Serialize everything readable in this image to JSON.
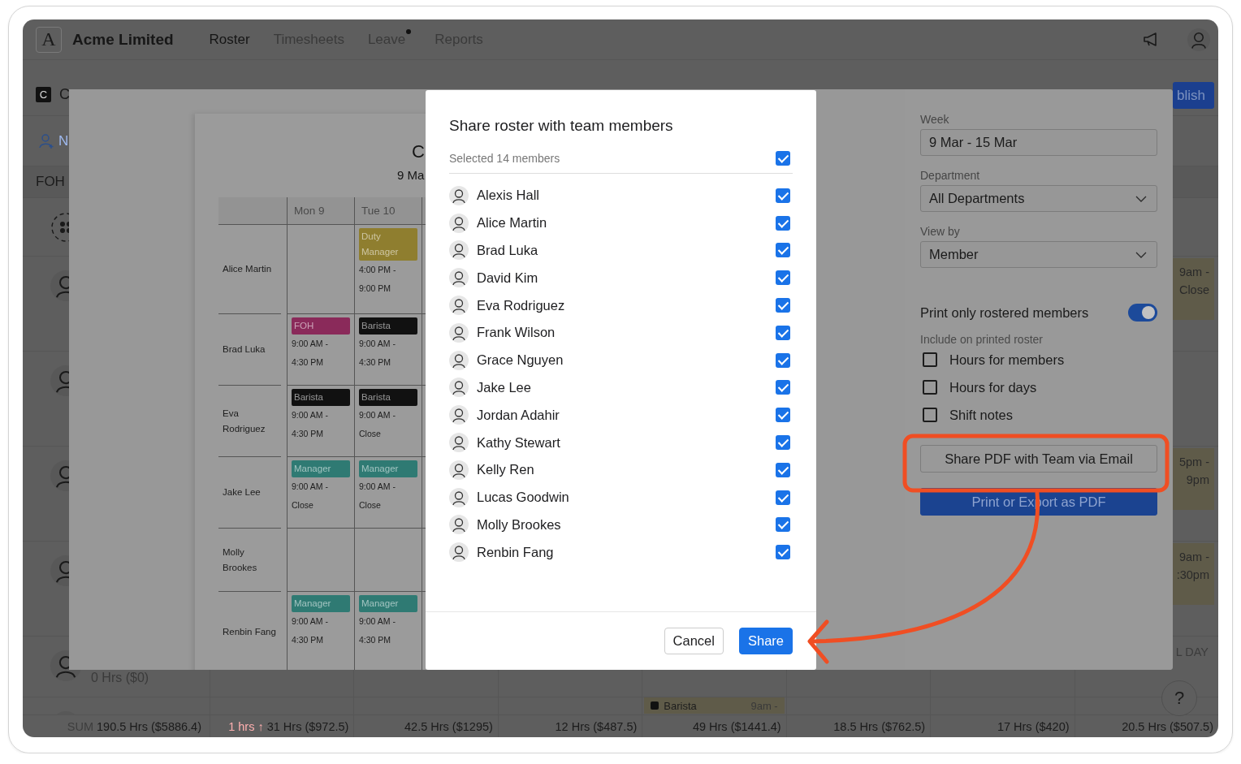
{
  "nav": {
    "logo": "A",
    "company": "Acme Limited",
    "tabs": [
      {
        "label": "Roster",
        "selected": true,
        "dot": false
      },
      {
        "label": "Timesheets",
        "selected": false,
        "dot": false
      },
      {
        "label": "Leave",
        "selected": false,
        "dot": true
      },
      {
        "label": "Reports",
        "selected": false,
        "dot": false
      }
    ]
  },
  "roster": {
    "location_badge": "C",
    "location_name": "C",
    "publish_button": "blish",
    "add_member": "N",
    "department": "FOH",
    "rows": [
      {
        "kind": "open_shifts"
      },
      {
        "kind": "member",
        "shift": {
          "kind": "time",
          "text": "9am - Close"
        }
      },
      {
        "kind": "member"
      },
      {
        "kind": "member",
        "shift": {
          "kind": "time",
          "text": "5pm - 9pm"
        }
      },
      {
        "kind": "member",
        "shift": {
          "kind": "time",
          "text": "9am - :30pm"
        }
      },
      {
        "kind": "member",
        "hours": "0 Hrs ($0)",
        "shift": {
          "kind": "allday",
          "text": "L DAY"
        }
      },
      {
        "kind": "member",
        "shift": {
          "kind": "role",
          "text": "Barista",
          "time": "9am -"
        }
      }
    ],
    "totals": [
      {
        "label": "SUM",
        "value": "190.5 Hrs ($5886.4)"
      },
      {
        "change": "1 hrs ↑",
        "value": "31 Hrs ($972.5)"
      },
      {
        "value": "42.5 Hrs ($1295)"
      },
      {
        "value": "12 Hrs ($487.5)"
      },
      {
        "value": "49 Hrs ($1441.4)"
      },
      {
        "value": "18.5 Hrs ($762.5)"
      },
      {
        "value": "17 Hrs ($420)"
      },
      {
        "value": "20.5 Hrs ($507.5)"
      }
    ],
    "help": "?"
  },
  "print_preview": {
    "title": "C",
    "subtitle": "9 Ma",
    "columns": [
      "Mon 9",
      "Tue 10"
    ],
    "rows": [
      {
        "name": "Alice Martin",
        "shifts": [
          {
            "kind": "none"
          },
          {
            "kind": "shift",
            "role": "Duty Manager",
            "color": "#8f7e2f",
            "time": "4:00 PM - 9:00 PM"
          }
        ]
      },
      {
        "name": "Brad Luka",
        "shifts": [
          {
            "kind": "shift",
            "role": "FOH",
            "color": "#8a2a5a",
            "time": "9:00 AM - 4:30 PM"
          },
          {
            "kind": "shift",
            "role": "Barista",
            "color": "#111111",
            "time": "9:00 AM - 4:30 PM"
          }
        ]
      },
      {
        "name": "Eva Rodriguez",
        "shifts": [
          {
            "kind": "shift",
            "role": "Barista",
            "color": "#111111",
            "time": "9:00 AM - 4:30 PM"
          },
          {
            "kind": "shift",
            "role": "Barista",
            "color": "#111111",
            "time": "9:00 AM - Close"
          }
        ]
      },
      {
        "name": "Jake Lee",
        "shifts": [
          {
            "kind": "shift",
            "role": "Manager",
            "color": "#2f7a73",
            "time": "9:00 AM - Close"
          },
          {
            "kind": "shift",
            "role": "Manager",
            "color": "#2f7a73",
            "time": "9:00 AM - Close"
          }
        ]
      },
      {
        "name": "Molly Brookes",
        "shifts": [
          {
            "kind": "none"
          },
          {
            "kind": "none"
          }
        ]
      },
      {
        "name": "Renbin Fang",
        "shifts": [
          {
            "kind": "shift",
            "role": "Manager",
            "color": "#2f7a73",
            "time": "9:00 AM - 4:30 PM"
          },
          {
            "kind": "shift",
            "role": "Manager",
            "color": "#2f7a73",
            "time": "9:00 AM - 4:30 PM"
          }
        ]
      }
    ]
  },
  "print_settings": {
    "fields": [
      {
        "label": "Week",
        "value": "9 Mar - 15 Mar",
        "kind": "text"
      },
      {
        "label": "Department",
        "value": "All Departments",
        "kind": "select"
      },
      {
        "label": "View by",
        "value": "Member",
        "kind": "select"
      }
    ],
    "toggle": {
      "label": "Print only rostered members",
      "on": true
    },
    "include_label": "Include on printed roster",
    "options": [
      {
        "label": "Hours for members",
        "checked": false
      },
      {
        "label": "Hours for days",
        "checked": false
      },
      {
        "label": "Shift notes",
        "checked": false
      }
    ],
    "buttons": [
      {
        "label": "Share PDF with Team via Email",
        "kind": "secondary"
      },
      {
        "label": "Print or Export as PDF",
        "kind": "primary"
      }
    ]
  },
  "share_dialog": {
    "title": "Share roster with team members",
    "selected_label": "Selected 14 members",
    "select_all": true,
    "members": [
      {
        "name": "Alexis Hall",
        "checked": true
      },
      {
        "name": "Alice Martin",
        "checked": true
      },
      {
        "name": "Brad Luka",
        "checked": true
      },
      {
        "name": "David Kim",
        "checked": true
      },
      {
        "name": "Eva Rodriguez",
        "checked": true
      },
      {
        "name": "Frank Wilson",
        "checked": true
      },
      {
        "name": "Grace Nguyen",
        "checked": true
      },
      {
        "name": "Jake Lee",
        "checked": true
      },
      {
        "name": "Jordan Adahir",
        "checked": true
      },
      {
        "name": "Kathy Stewart",
        "checked": true
      },
      {
        "name": "Kelly Ren",
        "checked": true
      },
      {
        "name": "Lucas Goodwin",
        "checked": true
      },
      {
        "name": "Molly Brookes",
        "checked": true
      },
      {
        "name": "Renbin Fang",
        "checked": true
      }
    ],
    "buttons": [
      {
        "label": "Cancel",
        "kind": "secondary"
      },
      {
        "label": "Share",
        "kind": "primary"
      }
    ]
  }
}
